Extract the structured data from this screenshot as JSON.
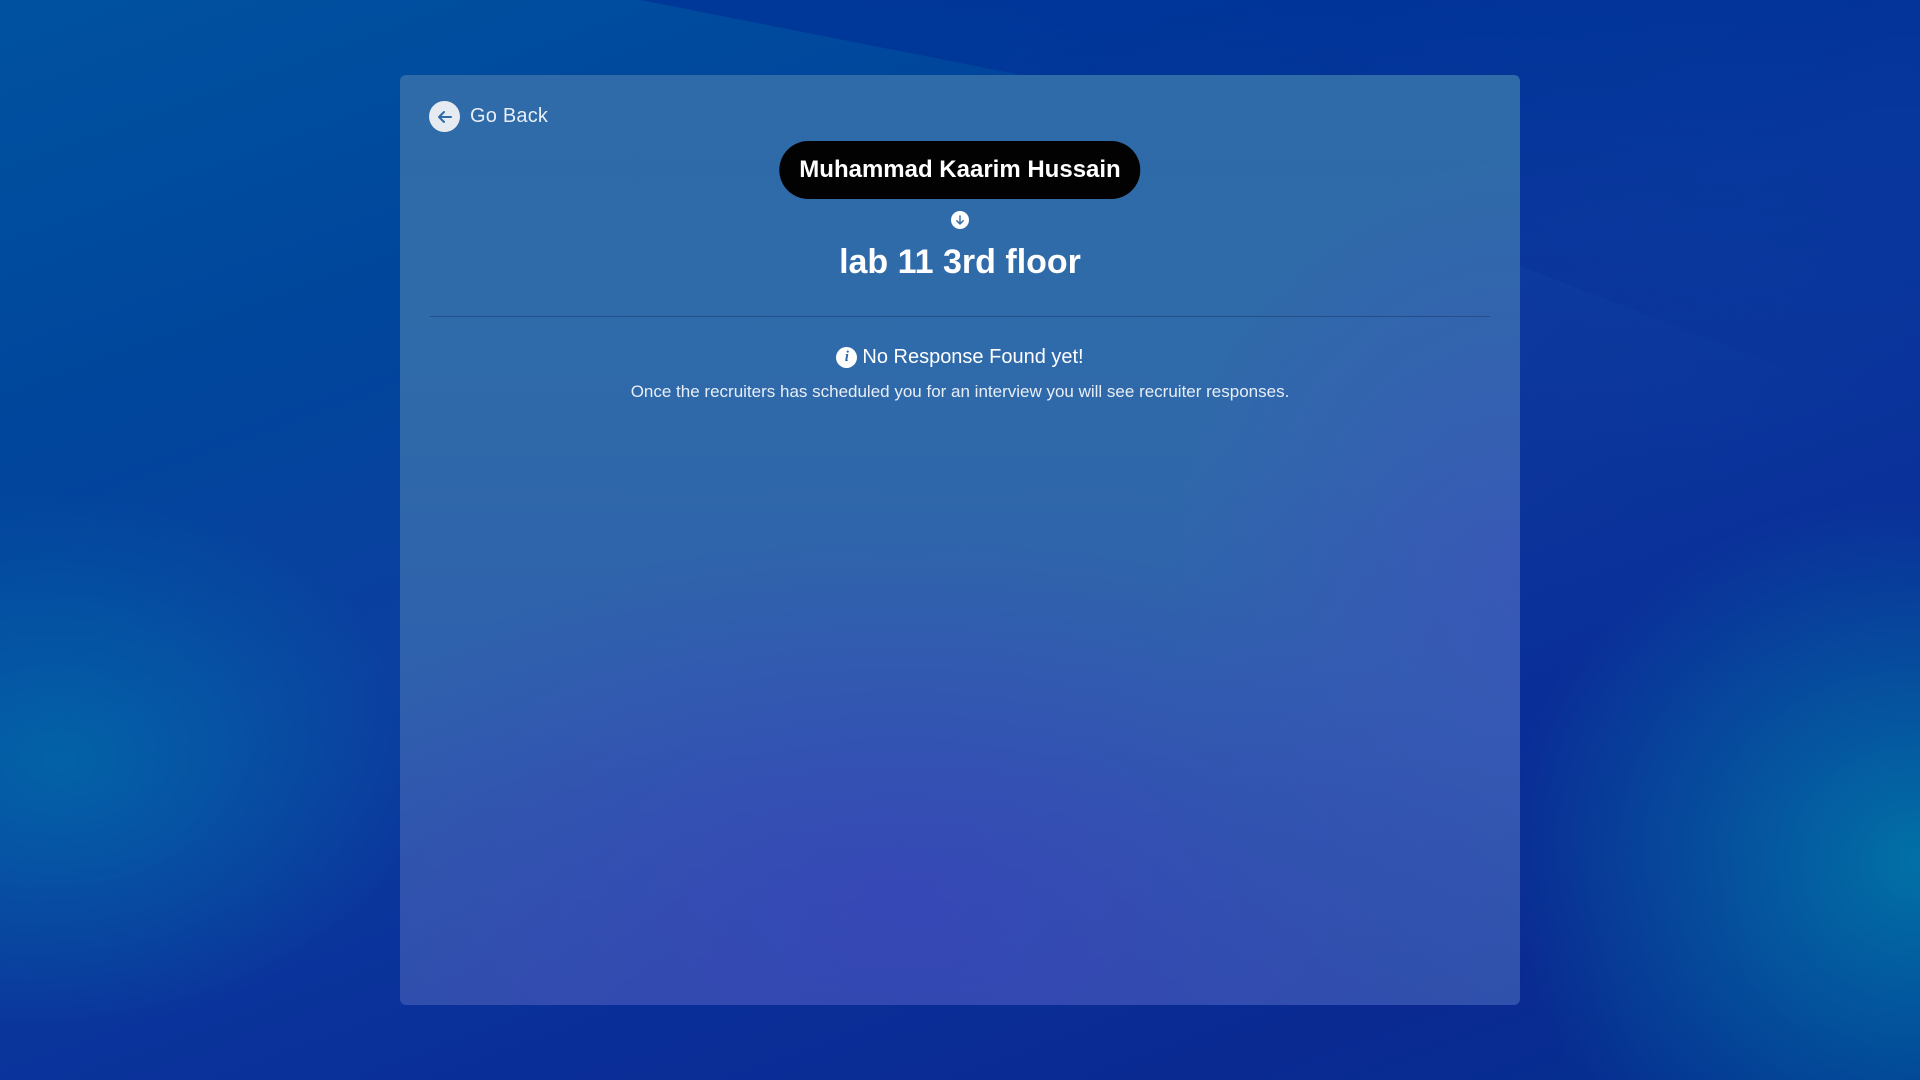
{
  "navigation": {
    "back_label": "Go Back"
  },
  "candidate": {
    "name": "Muhammad Kaarim Hussain"
  },
  "location": {
    "title": "lab 11 3rd floor"
  },
  "empty_state": {
    "title": "No Response Found yet!",
    "description": "Once the recruiters has scheduled you for an interview you will see recruiter responses."
  },
  "icons": {
    "back": "arrow-left-icon",
    "connector": "arrow-down-icon",
    "info": "info-icon"
  },
  "colors": {
    "card_background": "#2f6ba8",
    "name_pill_background": "#020202",
    "text": "#ffffff"
  }
}
